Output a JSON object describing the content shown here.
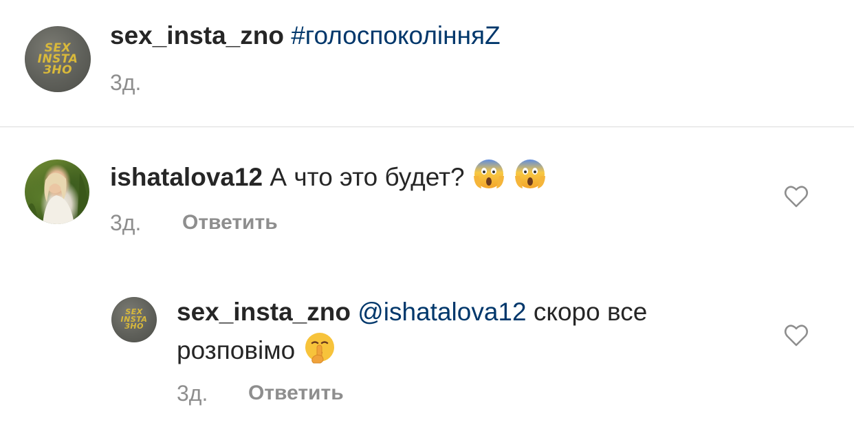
{
  "caption": {
    "username": "sex_insta_zno",
    "hashtag": "#голоспоколінняZ",
    "time": "3д.",
    "avatar_text": [
      "SEX",
      "INSTA",
      "ЗНО"
    ]
  },
  "comment": {
    "username": "ishatalova12",
    "text": "А что это будет?",
    "emojis": [
      "face-screaming-in-fear-emoji",
      "face-screaming-in-fear-emoji"
    ],
    "time": "3д.",
    "reply_label": "Ответить"
  },
  "reply": {
    "username": "sex_insta_zno",
    "mention": "@ishatalova12",
    "text_line1": "скоро все",
    "text_line2": "розповімо",
    "emoji": "shushing-face-emoji",
    "time": "3д.",
    "reply_label": "Ответить",
    "avatar_text": [
      "SEX",
      "INSTA",
      "ЗНО"
    ]
  },
  "colors": {
    "text": "#262626",
    "link": "#00376b",
    "meta": "#8e8e8e",
    "divider": "#dbdbdb",
    "brand_gold": "#d9b93a"
  }
}
